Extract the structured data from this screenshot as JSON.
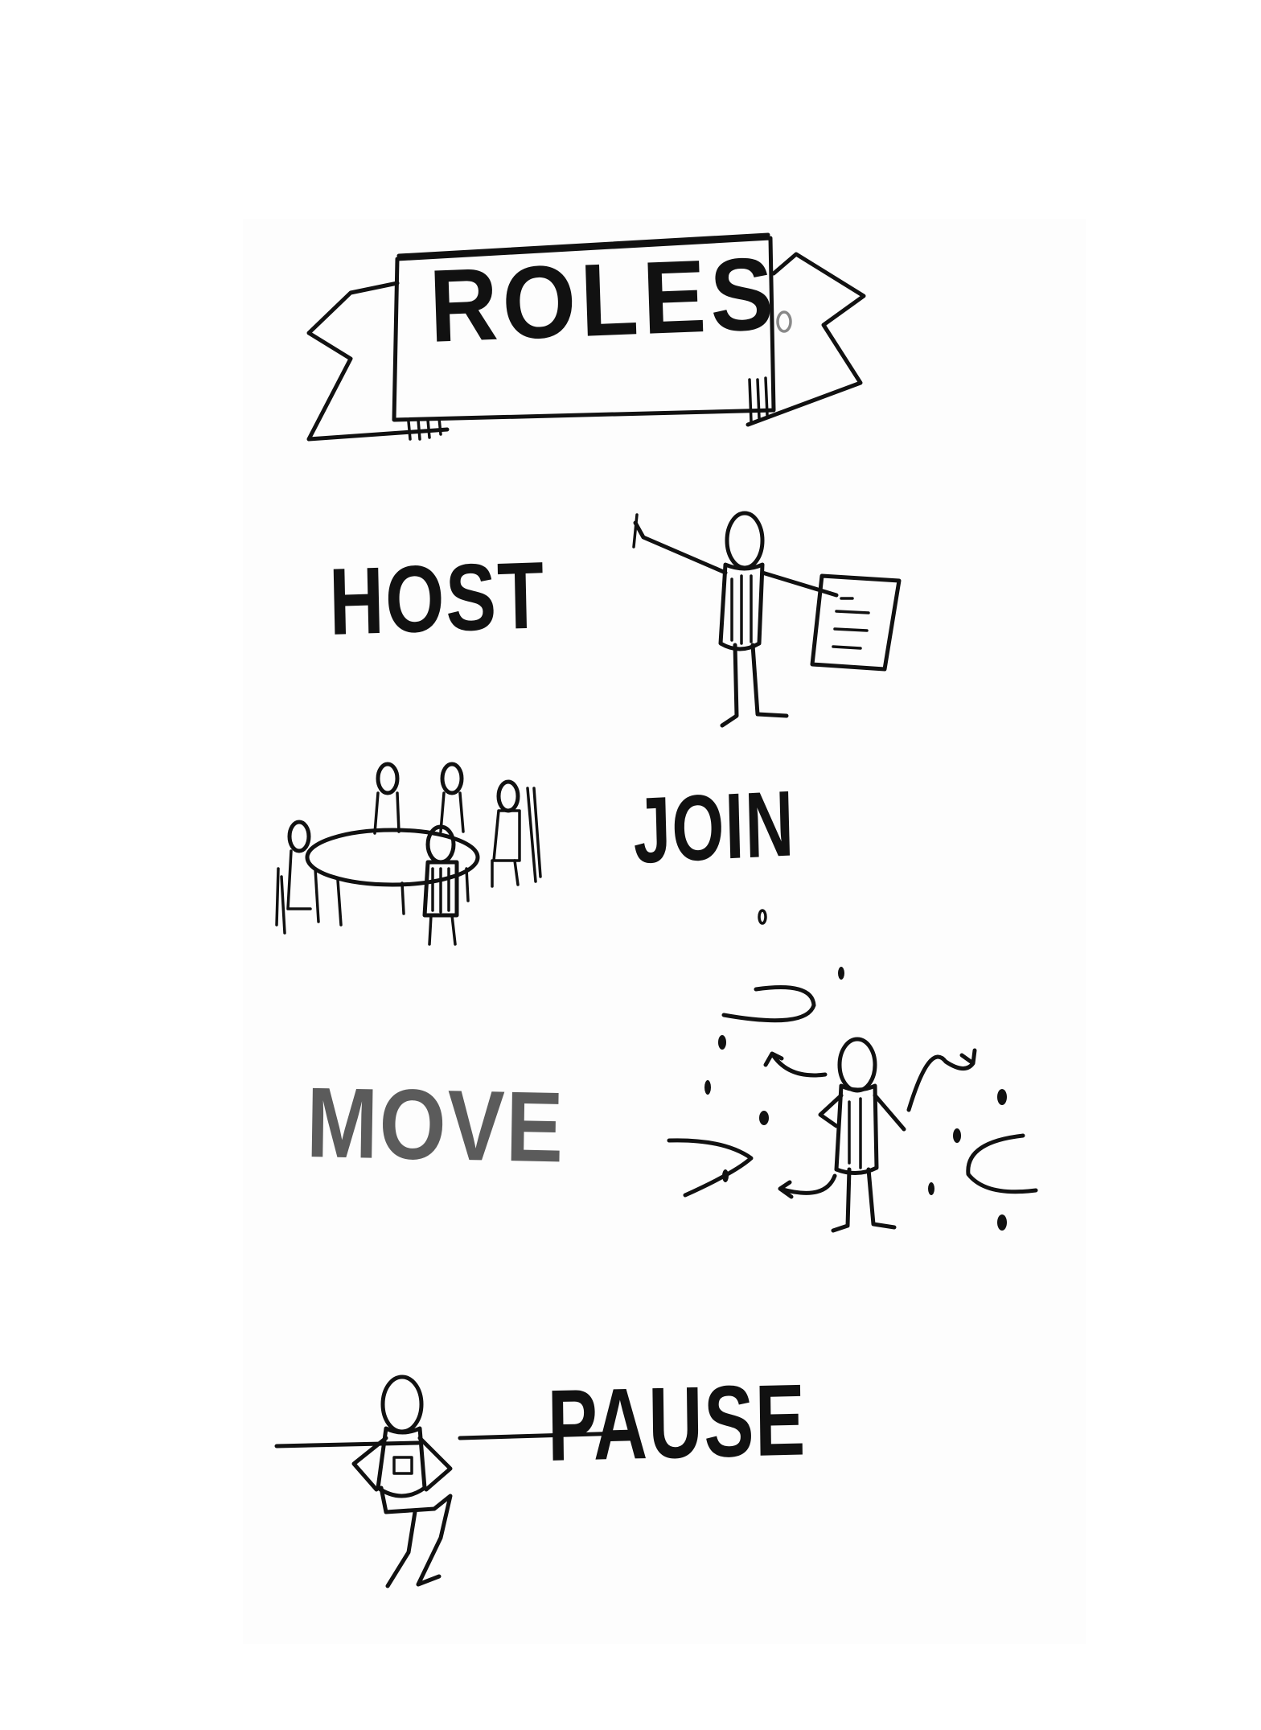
{
  "banner": {
    "title": "ROLES"
  },
  "roles": [
    {
      "word": "HOST"
    },
    {
      "word": "JOIN"
    },
    {
      "word": "MOVE"
    },
    {
      "word": "PAUSE"
    }
  ],
  "illustrations": {
    "host": "presenter-with-flipchart-icon",
    "join": "group-at-table-icon",
    "move": "person-with-motion-arrows-icon",
    "pause": "person-sitting-on-ledge-icon"
  },
  "colors": {
    "ink": "#111111",
    "move_ink": "#5b5b5b",
    "paper": "#fdfdfd"
  }
}
